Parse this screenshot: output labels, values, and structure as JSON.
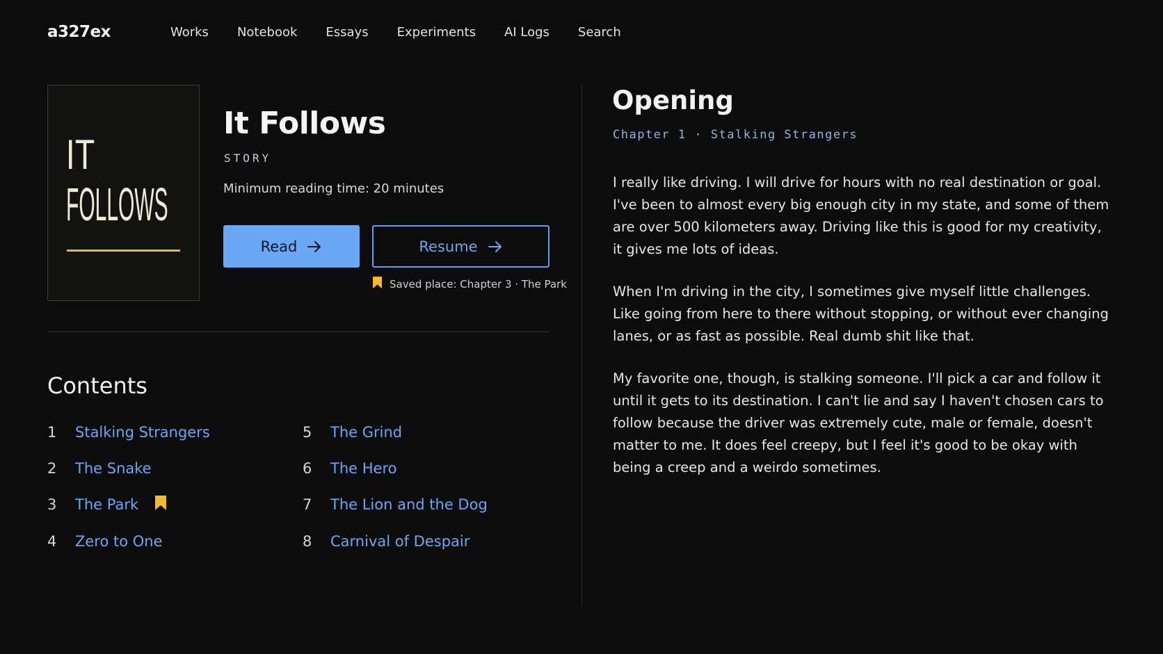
{
  "nav": {
    "brand": "a327ex",
    "links": [
      "Works",
      "Notebook",
      "Essays",
      "Experiments",
      "AI Logs",
      "Search"
    ]
  },
  "work": {
    "cover": {
      "line1": "IT",
      "line2": "FOLLOWS",
      "accent": "#e5b83a"
    },
    "title": "It Follows",
    "type": "STORY",
    "reading_time": "Minimum reading time: 20 minutes",
    "read_label": "Read",
    "resume_label": "Resume",
    "saved_place": "Saved place: Chapter 3 · The Park",
    "bookmark_color": "#f2bb2e"
  },
  "contents": {
    "title": "Contents",
    "chapters": [
      {
        "num": "1",
        "title": "Stalking Strangers",
        "bookmarked": false
      },
      {
        "num": "2",
        "title": "The Snake",
        "bookmarked": false
      },
      {
        "num": "3",
        "title": "The Park",
        "bookmarked": true
      },
      {
        "num": "4",
        "title": "Zero to One",
        "bookmarked": false
      },
      {
        "num": "5",
        "title": "The Grind",
        "bookmarked": false
      },
      {
        "num": "6",
        "title": "The Hero",
        "bookmarked": false
      },
      {
        "num": "7",
        "title": "The Lion and the Dog",
        "bookmarked": false
      },
      {
        "num": "8",
        "title": "Carnival of Despair",
        "bookmarked": false
      }
    ]
  },
  "preview": {
    "title": "Opening",
    "chapter_label": "Chapter 1 · Stalking Strangers",
    "paragraphs": [
      "I really like driving. I will drive for hours with no real destination or goal. I've been to almost every big enough city in my state, and some of them are over 500 kilometers away. Driving like this is good for my creativity, it gives me lots of ideas.",
      "When I'm driving in the city, I sometimes give myself little challenges. Like going from here to there without stopping, or without ever changing lanes, or as fast as possible. Real dumb shit like that.",
      "My favorite one, though, is stalking someone. I'll pick a car and follow it until it gets to its destination. I can't lie and say I haven't chosen cars to follow because the driver was extremely cute, male or female, doesn't matter to me. It does feel creepy, but I feel it's good to be okay with being a creep and a weirdo sometimes."
    ]
  },
  "colors": {
    "background": "#0c0c0d",
    "link": "#6aa8f5",
    "chapter_label": "#93b4dc"
  }
}
